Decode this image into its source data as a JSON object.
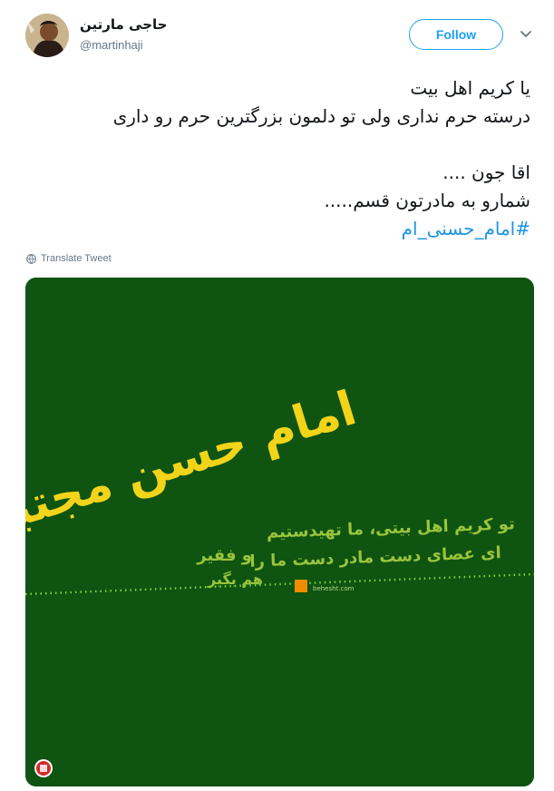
{
  "user": {
    "display_name": "حاجی مارتین",
    "handle": "@martinhaji"
  },
  "follow_label": "Follow",
  "tweet": {
    "lines": [
      "یا کریم اهل بیت",
      "درسته حرم نداری ولی تو دلمون بزرگترین حرم رو داری",
      "",
      "اقا جون ....",
      "شمارو به مادرتون قسم....."
    ],
    "hashtag": "#امام_حسنی_ام"
  },
  "translate_label": "Translate Tweet",
  "media": {
    "background": "#0f5411",
    "title": "امام حسن مجتبی علیه السلام",
    "verse_line_1": "تو کریم اهل بیتی، ما تهیدستیم",
    "verse_line_2": "ای عصای دست مادر دست ما را",
    "verse_line_3": "و فقیر",
    "verse_line_4": "هم بگیر",
    "credit": "behesht.com",
    "colors": {
      "title": "#f2d41b",
      "verse": "#9ac43c",
      "dots": "#7fd63a",
      "accent": "#f08c00"
    }
  }
}
